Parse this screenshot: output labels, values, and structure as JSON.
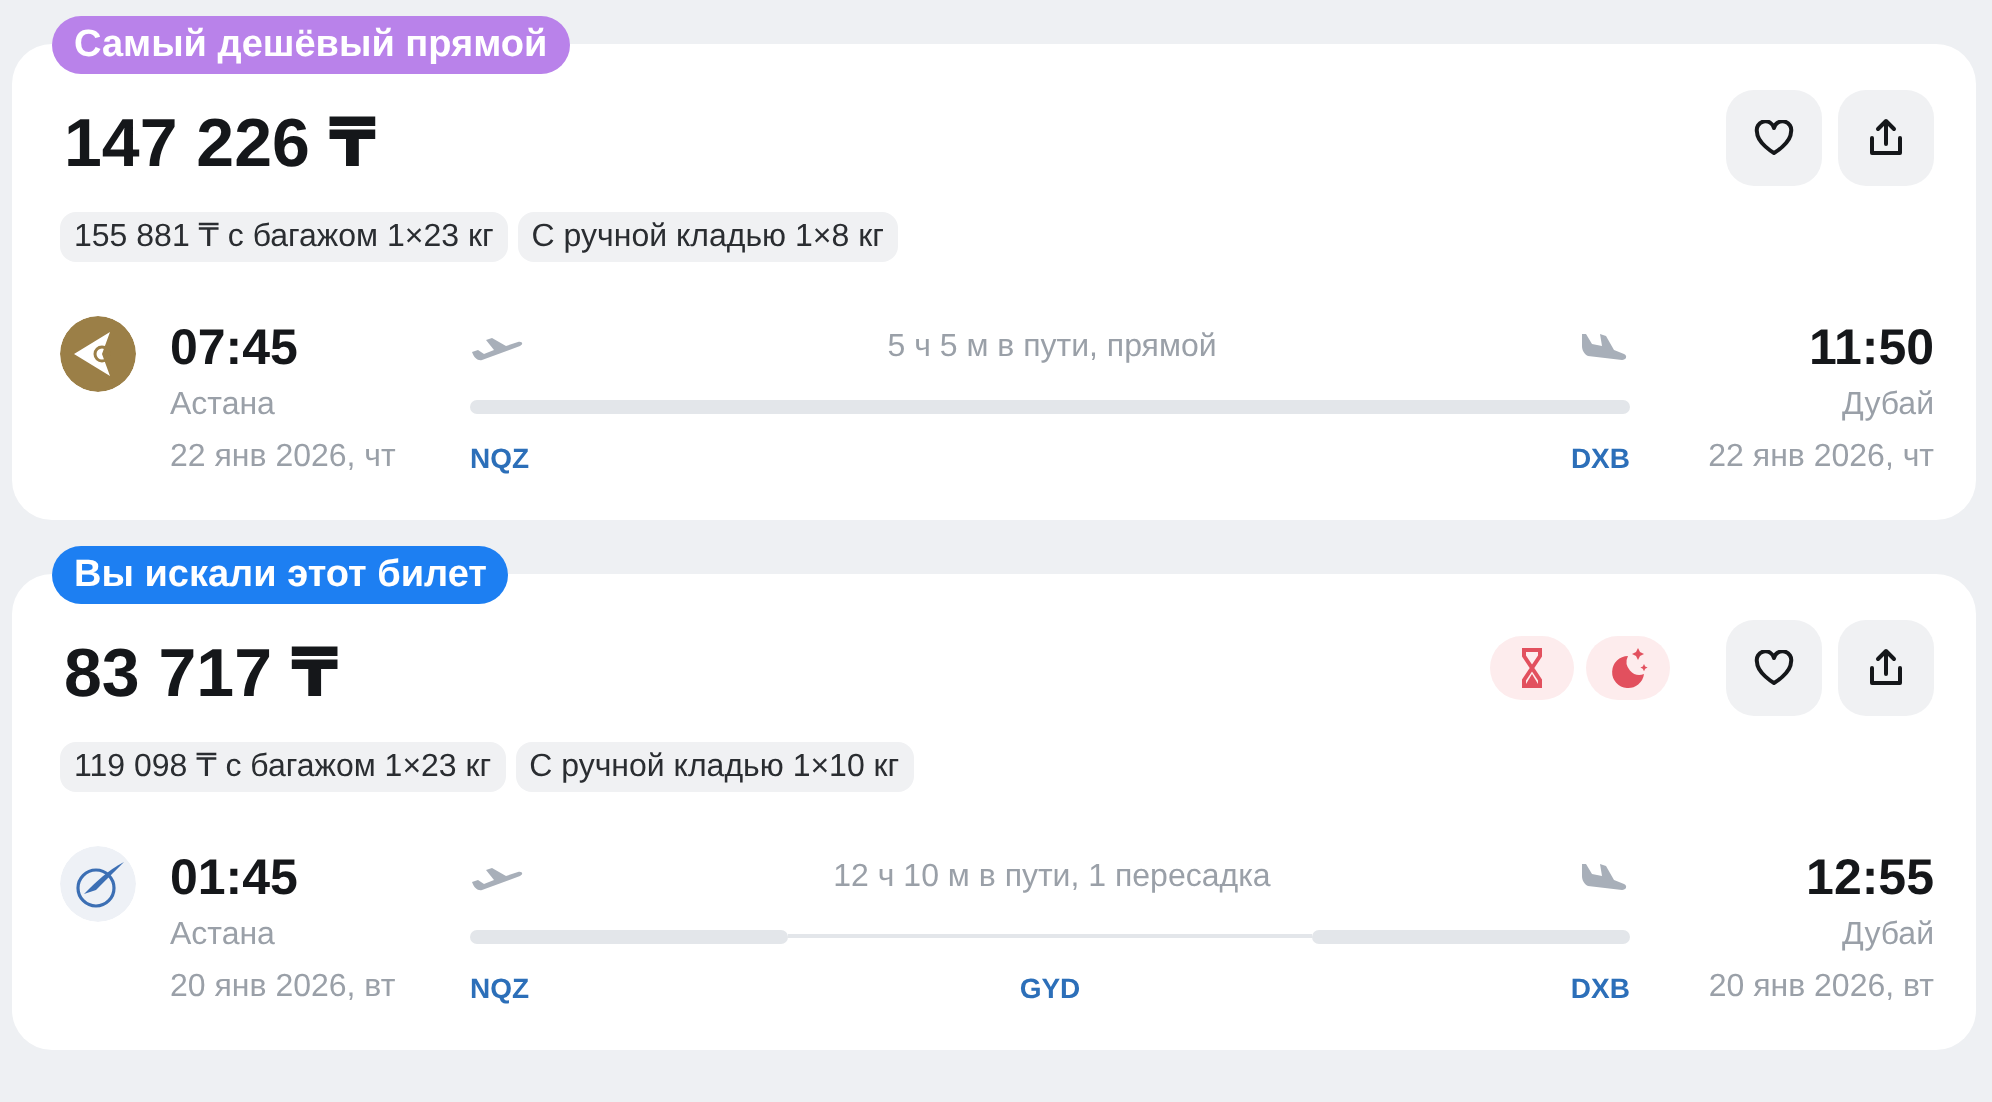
{
  "tickets": [
    {
      "badge": {
        "text": "Самый дешёвый прямой",
        "kind": "cheapest"
      },
      "price": "147 226 ₸",
      "options": [
        "155 881 ₸ с багажом 1×23 кг",
        "С ручной кладью 1×8 кг"
      ],
      "airline": {
        "kind": "gold"
      },
      "departure": {
        "time": "07:45",
        "city": "Астана",
        "date": "22 янв 2026, чт",
        "code": "NQZ"
      },
      "arrival": {
        "time": "11:50",
        "city": "Дубай",
        "date": "22 янв 2026, чт",
        "code": "DXB"
      },
      "duration": "5 ч 5 м в пути, прямой"
    },
    {
      "badge": {
        "text": "Вы искали этот билет",
        "kind": "searched"
      },
      "price": "83 717 ₸",
      "options": [
        "119 098 ₸ с багажом 1×23 кг",
        "С ручной кладью 1×10 кг"
      ],
      "features": [
        {
          "kind": "hourglass"
        },
        {
          "kind": "night"
        }
      ],
      "airline": {
        "kind": "light"
      },
      "departure": {
        "time": "01:45",
        "city": "Астана",
        "date": "20 янв 2026, вт",
        "code": "NQZ"
      },
      "arrival": {
        "time": "12:55",
        "city": "Дубай",
        "date": "20 янв 2026, вт",
        "code": "DXB"
      },
      "duration": "12 ч 10 м в пути, 1 пересадка",
      "stops": [
        {
          "code": "GYD"
        }
      ]
    }
  ]
}
